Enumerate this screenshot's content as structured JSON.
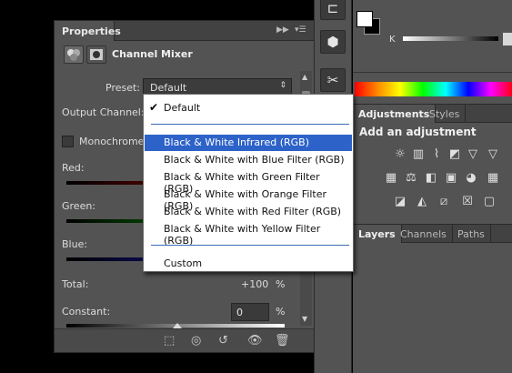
{
  "properties_panel": {
    "tab_label": "Properties",
    "title": "Channel Mixer",
    "preset_label": "Preset:",
    "preset_value": "Default",
    "output_channel_label": "Output Channel:",
    "monochrome_label": "Monochrome",
    "red_label": "Red:",
    "green_label": "Green:",
    "blue_label": "Blue:",
    "total_label": "Total:",
    "total_value": "+100",
    "total_unit": "%",
    "constant_label": "Constant:",
    "constant_value": "0",
    "constant_unit": "%"
  },
  "preset_dropdown": {
    "items": [
      {
        "label": "Default",
        "checked": true
      },
      {
        "label": "Black & White Infrared (RGB)",
        "highlighted": true
      },
      {
        "label": "Black & White with Blue Filter (RGB)"
      },
      {
        "label": "Black & White with Green Filter (RGB)"
      },
      {
        "label": "Black & White with Orange Filter (RGB)"
      },
      {
        "label": "Black & White with Red Filter (RGB)"
      },
      {
        "label": "Black & White with Yellow Filter (RGB)"
      },
      {
        "label": "Custom"
      }
    ],
    "check_glyph": "✔"
  },
  "right_panels": {
    "color": {
      "slider_label": "K"
    },
    "adjustments_tabs": [
      "Adjustments",
      "Styles"
    ],
    "adjustments_heading": "Add an adjustment",
    "layers_tabs": [
      "Layers",
      "Channels",
      "Paths"
    ]
  },
  "colors": {
    "panel_bg": "#535353",
    "highlight": "#2d62c9",
    "red_slider": "#b00000",
    "green_slider": "#00a000",
    "blue_slider": "#1c1cc8"
  }
}
